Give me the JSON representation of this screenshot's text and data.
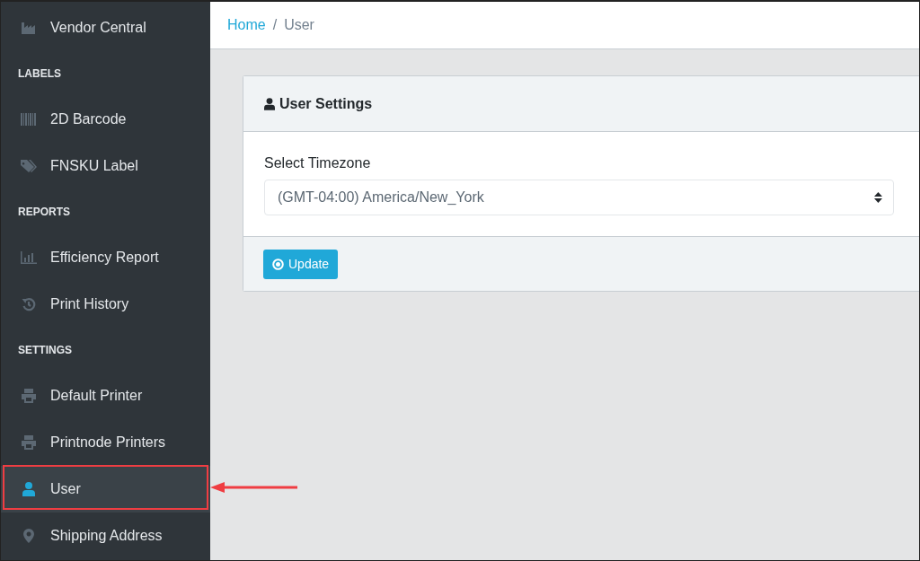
{
  "sidebar": {
    "entries": [
      {
        "kind": "link",
        "label": "Vendor Central",
        "selected": false,
        "highlighted": false
      },
      {
        "kind": "heading",
        "label": "LABELS"
      },
      {
        "kind": "link",
        "label": "2D Barcode",
        "selected": false,
        "highlighted": false
      },
      {
        "kind": "link",
        "label": "FNSKU Label",
        "selected": false,
        "highlighted": false
      },
      {
        "kind": "heading",
        "label": "REPORTS"
      },
      {
        "kind": "link",
        "label": "Efficiency Report",
        "selected": false,
        "highlighted": false
      },
      {
        "kind": "link",
        "label": "Print History",
        "selected": false,
        "highlighted": false
      },
      {
        "kind": "heading",
        "label": "SETTINGS"
      },
      {
        "kind": "link",
        "label": "Default Printer",
        "selected": false,
        "highlighted": false
      },
      {
        "kind": "link",
        "label": "Printnode Printers",
        "selected": false,
        "highlighted": false
      },
      {
        "kind": "link",
        "label": "User",
        "selected": true,
        "highlighted": true
      },
      {
        "kind": "link",
        "label": "Shipping Address",
        "selected": false,
        "highlighted": false
      }
    ]
  },
  "breadcrumb": [
    {
      "label": "Home",
      "link": true
    },
    {
      "label": "/",
      "link": false
    },
    {
      "label": "User",
      "link": false
    }
  ],
  "card": {
    "title": "User Settings",
    "field_label": "Select Timezone",
    "select_value": "(GMT-04:00) America/New_York",
    "button": "Update"
  }
}
